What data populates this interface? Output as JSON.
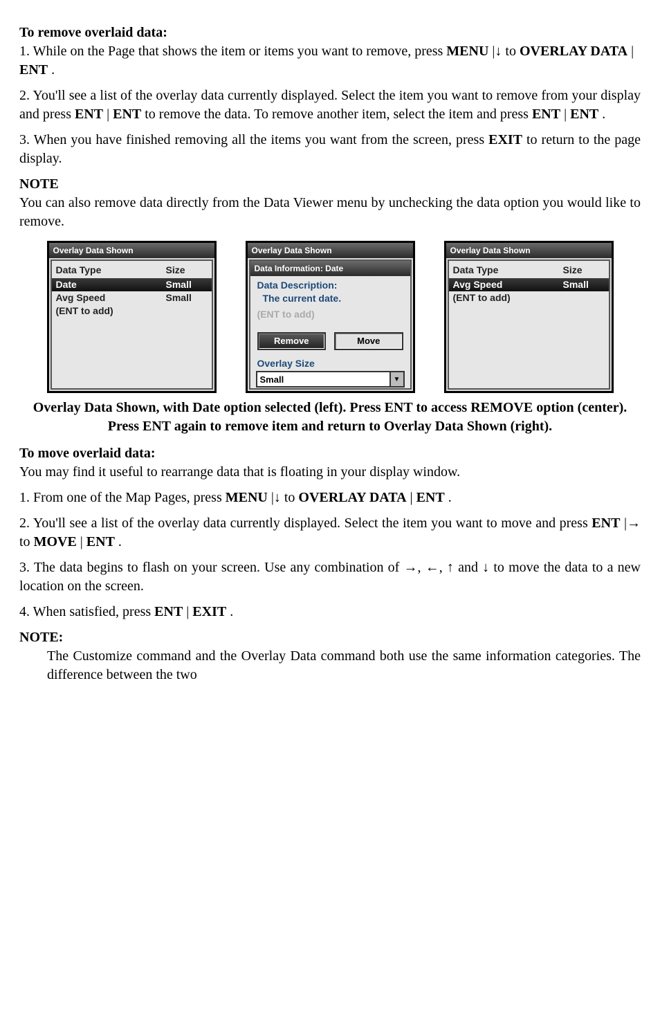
{
  "h1": "To remove overlaid data:",
  "p1a": "1. While on the Page that shows the item or items you want to remove, press ",
  "p1b": "|↓ to ",
  "p1c": "| ",
  "p1d": ".",
  "p2a": "2. You'll see a list of the overlay data currently displayed. Select the item you want to remove from your display and press ",
  "p2b": "| ",
  "p2c": "to remove the data. To remove another item, select the item and press ",
  "p2d": "| ",
  "p2e": ".",
  "p3a": "3. When you have finished removing all the items you want from the screen, press ",
  "p3b": "to return to the page display.",
  "noteHead": "NOTE",
  "notePara": "You can also remove data directly from the Data Viewer menu by unchecking the data option you would like to remove.",
  "shots": {
    "title": "Overlay Data Shown",
    "colType": "Data Type",
    "colSize": "Size",
    "rows": [
      {
        "label": "Date",
        "size": "Small"
      },
      {
        "label": "Avg Speed",
        "size": "Small"
      }
    ],
    "entHint": "(ENT to add)",
    "center": {
      "subhdr": "Data Information: Date",
      "descLabel": "Data Description:",
      "descText": "The current date.",
      "ghost": "(ENT to add)",
      "btnRemove": "Remove",
      "btnMove": "Move",
      "ovLabel": "Overlay Size",
      "ddValue": "Small"
    }
  },
  "captionA": "Overlay Data Shown, with Date option selected (left). Press ",
  "captionB": "to access ",
  "captionC": "option (center). Press ",
  "captionD": "again to remove item and return to Overlay Data Shown (right).",
  "h2": "To move overlaid data:",
  "m0": "You may find it useful to rearrange data that is floating in your display window.",
  "m1a": "1. From one of the Map Pages, press ",
  "m1b": "|↓ to ",
  "m1c": "| ",
  "m1d": ".",
  "m2a": "2. You'll see a list of the overlay data currently displayed. Select the item you want to move and press ",
  "m2b": "|→ to ",
  "m2c": "| ",
  "m2d": ".",
  "m3": "3. The data begins to flash on your screen. Use any combination of →, ←, ↑ and ↓ to move the data to a new location on the screen.",
  "m4a": "4. When satisfied, press ",
  "m4b": "| ",
  "m4c": ".",
  "noteHead2": "NOTE:",
  "notePara2": "The Customize command and the Overlay Data command both use the same information categories. The difference between the two"
}
